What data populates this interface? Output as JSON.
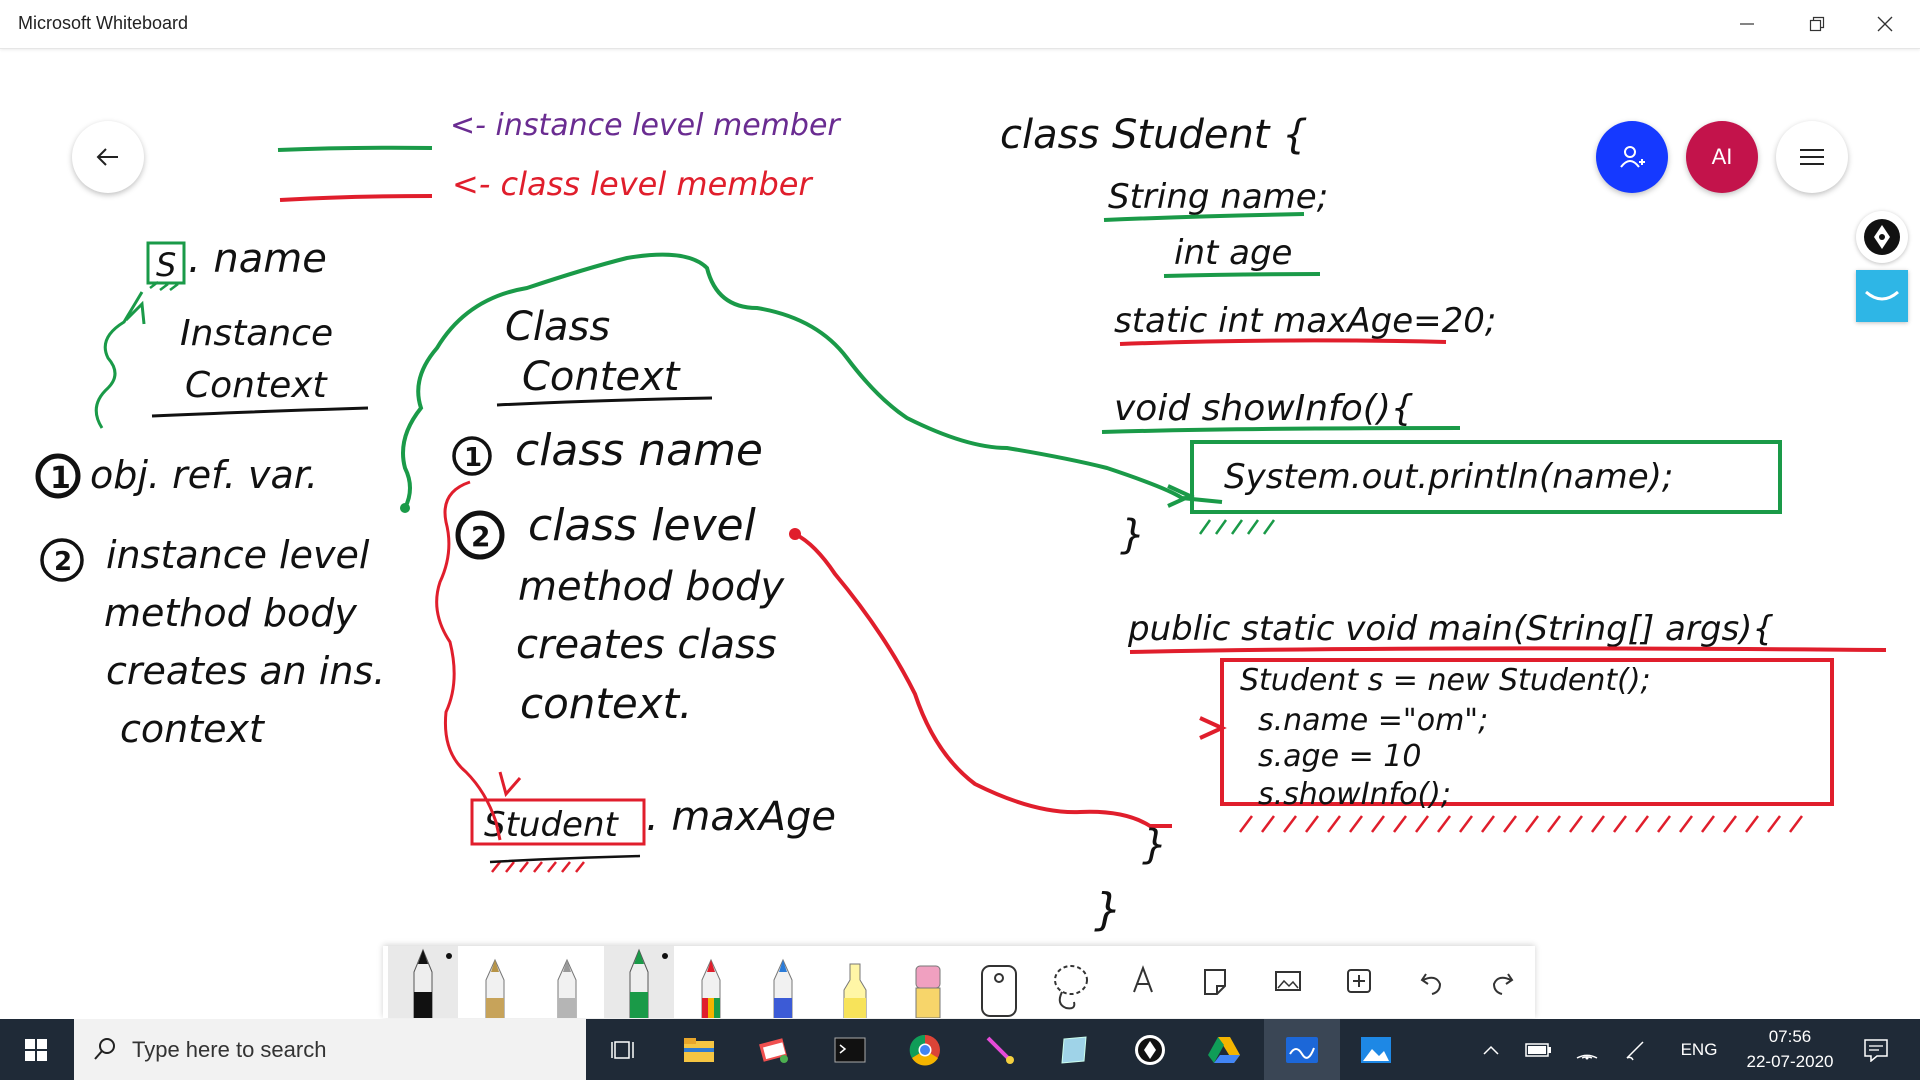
{
  "window": {
    "title": "Microsoft Whiteboard"
  },
  "header": {
    "avatar_initials": "AI"
  },
  "colors": {
    "green_ink": "#1a9a48",
    "red_ink": "#e01e2c",
    "purple_ink": "#6a2c91",
    "invite_blue": "#1539ff",
    "avatar_red": "#c3134b",
    "taskbar_bg": "#1f2a37"
  },
  "legend": {
    "instance_label": "<- instance level member",
    "class_label": "<- class level member"
  },
  "left_notes": {
    "s_name_box": "S",
    "s_name_rest": ". name",
    "instance_context_line1": "Instance",
    "instance_context_line2": "Context",
    "item1_num": "1",
    "item1_text": "obj. ref. var.",
    "item2_num": "2",
    "item2_line1": "instance level",
    "item2_line2": "method body",
    "item2_line3": "creates an ins.",
    "item2_line4": "context"
  },
  "middle_notes": {
    "class_context_line1": "Class",
    "class_context_line2": "Context",
    "item1_num": "1",
    "item1_text": "class name",
    "item2_num": "2",
    "item2_line1": "class level",
    "item2_line2": "method body",
    "item2_line3": "creates class",
    "item2_line4": "context.",
    "student_box": "Student",
    "student_rest": ". maxAge"
  },
  "code": {
    "line_class": "class  Student {",
    "line_name": "String name;",
    "line_age": "int age",
    "line_static": "static int maxAge=20;",
    "line_show": "void  showInfo(){",
    "line_println": "System.out.println(name);",
    "line_close1": "}",
    "line_main": "public static void  main(String[] args){",
    "line_new": "Student  s = new  Student();",
    "line_setname": "s.name =\"om\";",
    "line_setage": "s.age  =  10",
    "line_call": "s.showInfo();",
    "line_close2": "}",
    "line_close3": "}"
  },
  "toolbar": {
    "tools": [
      "black-pen",
      "gold-pen",
      "silver-pen",
      "green-pen",
      "rainbow-pen",
      "galaxy-pen",
      "highlighter",
      "eraser",
      "ruler",
      "lasso",
      "text",
      "note",
      "image",
      "add",
      "undo",
      "redo"
    ]
  },
  "taskbar": {
    "search_placeholder": "Type here to search",
    "language": "ENG",
    "time": "07:56",
    "date": "22-07-2020"
  }
}
